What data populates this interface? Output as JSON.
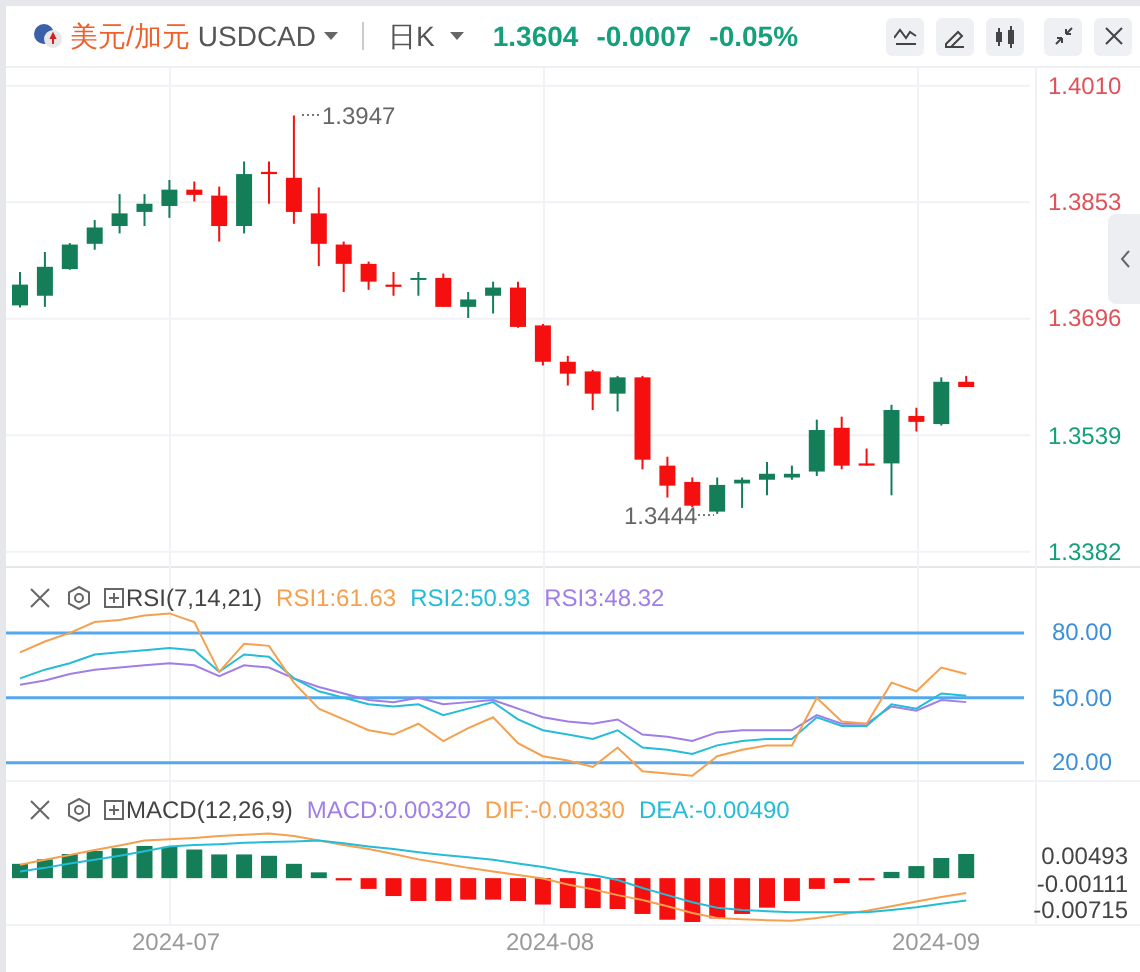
{
  "header": {
    "pair_name": "美元/加元",
    "symbol": "USDCAD",
    "interval": "日K",
    "price": "1.3604",
    "change": "-0.0007",
    "change_percent": "-0.05%"
  },
  "price_chart": {
    "high_marker": "1.3947",
    "low_marker": "1.3444",
    "chart_data": {
      "type": "candlestick",
      "ylim": [
        1.336,
        1.4034
      ],
      "grid": true,
      "yticks": [
        {
          "value": 1.401,
          "label": "1.4010"
        },
        {
          "value": 1.3853,
          "label": "1.3853"
        },
        {
          "value": 1.3696,
          "label": "1.3696"
        },
        {
          "value": 1.3539,
          "label": "1.3539"
        },
        {
          "value": 1.3382,
          "label": "1.3382"
        }
      ],
      "ohlc": [
        [
          1.3714,
          1.3759,
          1.3711,
          1.3742
        ],
        [
          1.3727,
          1.3786,
          1.3712,
          1.3766
        ],
        [
          1.3763,
          1.3798,
          1.3762,
          1.3796
        ],
        [
          1.3797,
          1.3829,
          1.3789,
          1.3819
        ],
        [
          1.3821,
          1.3864,
          1.3811,
          1.3838
        ],
        [
          1.384,
          1.3864,
          1.3821,
          1.3851
        ],
        [
          1.3848,
          1.3883,
          1.3832,
          1.387
        ],
        [
          1.387,
          1.3881,
          1.3854,
          1.3863
        ],
        [
          1.3862,
          1.3874,
          1.38,
          1.3821
        ],
        [
          1.3821,
          1.3908,
          1.3811,
          1.3891
        ],
        [
          1.3894,
          1.3908,
          1.3851,
          1.3891
        ],
        [
          1.3886,
          1.397,
          1.3824,
          1.384
        ],
        [
          1.3838,
          1.3873,
          1.3767,
          1.3797
        ],
        [
          1.3796,
          1.38,
          1.3732,
          1.377
        ],
        [
          1.377,
          1.3773,
          1.3735,
          1.3746
        ],
        [
          1.3742,
          1.3759,
          1.3727,
          1.3739
        ],
        [
          1.3749,
          1.3759,
          1.3727,
          1.3751
        ],
        [
          1.3751,
          1.3757,
          1.3712,
          1.3712
        ],
        [
          1.3712,
          1.3732,
          1.3697,
          1.3722
        ],
        [
          1.3727,
          1.3746,
          1.3703,
          1.3738
        ],
        [
          1.3738,
          1.3746,
          1.3684,
          1.3685
        ],
        [
          1.3687,
          1.3689,
          1.3633,
          1.3638
        ],
        [
          1.3638,
          1.3646,
          1.3606,
          1.3622
        ],
        [
          1.3625,
          1.3627,
          1.3573,
          1.3595
        ],
        [
          1.3595,
          1.3619,
          1.3571,
          1.3617
        ],
        [
          1.3617,
          1.3619,
          1.3493,
          1.3506
        ],
        [
          1.3498,
          1.351,
          1.3455,
          1.3471
        ],
        [
          1.3476,
          1.3482,
          1.3442,
          1.3444
        ],
        [
          1.3436,
          1.3482,
          1.3433,
          1.3472
        ],
        [
          1.3474,
          1.3482,
          1.3441,
          1.3479
        ],
        [
          1.3479,
          1.3503,
          1.3458,
          1.3487
        ],
        [
          1.3482,
          1.3498,
          1.3479,
          1.3487
        ],
        [
          1.349,
          1.356,
          1.3484,
          1.3546
        ],
        [
          1.3549,
          1.3564,
          1.3493,
          1.3498
        ],
        [
          1.3501,
          1.3521,
          1.3498,
          1.3498
        ],
        [
          1.3501,
          1.358,
          1.3458,
          1.3573
        ],
        [
          1.3565,
          1.3576,
          1.3544,
          1.3557
        ],
        [
          1.3554,
          1.3617,
          1.3552,
          1.3611
        ],
        [
          1.3611,
          1.3619,
          1.3604,
          1.3604
        ]
      ]
    }
  },
  "rsi": {
    "title": "RSI(7,14,21)",
    "chart_data": {
      "type": "line",
      "ylim": [
        12,
        110
      ],
      "grid": true,
      "yticks": [
        {
          "value": 80,
          "label": "80.00"
        },
        {
          "value": 50,
          "label": "50.00"
        },
        {
          "value": 20,
          "label": "20.00"
        }
      ],
      "series": [
        {
          "name": "RSI1:61.63",
          "color": "#f5a04e",
          "values": [
            71,
            76,
            80,
            85,
            86,
            88,
            89,
            85,
            62,
            75,
            74,
            57,
            45,
            40,
            35,
            33,
            38,
            30,
            36,
            41,
            29,
            23,
            21,
            18,
            27,
            16,
            15,
            14,
            23,
            26,
            28,
            28,
            50,
            39,
            38,
            57,
            53,
            64,
            61
          ]
        },
        {
          "name": "RSI2:50.93",
          "color": "#25bcd8",
          "values": [
            59,
            63,
            66,
            70,
            71,
            72,
            73,
            72,
            62,
            70,
            69,
            59,
            53,
            50,
            47,
            46,
            47,
            42,
            45,
            48,
            40,
            35,
            33,
            31,
            35,
            27,
            26,
            24,
            28,
            30,
            31,
            31,
            41,
            37,
            37,
            47,
            45,
            52,
            51
          ]
        },
        {
          "name": "RSI3:48.32",
          "color": "#a07ee8",
          "values": [
            56,
            58,
            61,
            63,
            64,
            65,
            66,
            65,
            60,
            65,
            64,
            59,
            55,
            52,
            49,
            48,
            50,
            47,
            48,
            49,
            45,
            41,
            39,
            38,
            40,
            33,
            32,
            30,
            34,
            35,
            35,
            35,
            42,
            38,
            38,
            46,
            44,
            49,
            48
          ]
        }
      ]
    }
  },
  "macd": {
    "title": "MACD(12,26,9)",
    "legend": [
      {
        "label": "MACD:0.00320",
        "color": "#a07ee8"
      },
      {
        "label": "DIF:-0.00330",
        "color": "#f5a04e"
      },
      {
        "label": "DEA:-0.00490",
        "color": "#25bcd8"
      }
    ],
    "chart_data": {
      "type": "bar",
      "ylim": [
        -0.0107,
        0.0215
      ],
      "grid": true,
      "yticks": [
        {
          "value": 0.00493,
          "label": "0.00493"
        },
        {
          "value": -0.00111,
          "label": "-0.00111"
        },
        {
          "value": -0.00715,
          "label": "-0.00715"
        }
      ],
      "series": [
        {
          "color": "#137e58",
          "type": "bar",
          "values": [
            0.0032,
            0.0042,
            0.0054,
            0.0061,
            0.0067,
            0.0072,
            0.007,
            0.0064,
            0.0053,
            0.0053,
            0.005,
            0.0032,
            0.0013,
            null,
            null,
            null,
            null,
            null,
            null,
            null,
            null,
            null,
            null,
            null,
            null,
            null,
            null,
            null,
            null,
            null,
            null,
            null,
            null,
            null,
            null,
            0.0014,
            0.0027,
            0.0045,
            0.0054
          ]
        },
        {
          "color": "#f50f0f",
          "type": "bar",
          "values": [
            null,
            null,
            null,
            null,
            null,
            null,
            null,
            null,
            null,
            null,
            null,
            null,
            null,
            -0.0005,
            -0.0024,
            -0.004,
            -0.0051,
            -0.0051,
            -0.0048,
            -0.0048,
            -0.0051,
            -0.0059,
            -0.0067,
            -0.0067,
            -0.0069,
            -0.008,
            -0.0093,
            -0.0098,
            -0.009,
            -0.008,
            -0.0066,
            -0.0051,
            -0.0024,
            -0.0011,
            -0.0005,
            null,
            null,
            null,
            null
          ]
        },
        {
          "color": "#f5a04e",
          "type": "line",
          "values": [
            0.003,
            0.0041,
            0.0052,
            0.0063,
            0.0073,
            0.0084,
            0.0087,
            0.009,
            0.0094,
            0.0097,
            0.01,
            0.0094,
            0.0084,
            0.0074,
            0.0065,
            0.0054,
            0.0042,
            0.0033,
            0.0023,
            0.0015,
            0.0007,
            -0.0001,
            -0.0014,
            -0.0025,
            -0.0038,
            -0.0049,
            -0.0063,
            -0.0078,
            -0.0089,
            -0.0092,
            -0.0094,
            -0.0095,
            -0.0089,
            -0.0081,
            -0.0073,
            -0.0063,
            -0.0052,
            -0.0042,
            -0.0033
          ]
        },
        {
          "color": "#25bcd8",
          "type": "line",
          "values": [
            0.0015,
            0.0023,
            0.0033,
            0.0041,
            0.005,
            0.006,
            0.0071,
            0.0074,
            0.0076,
            0.0079,
            0.0081,
            0.0082,
            0.0084,
            0.0078,
            0.0071,
            0.0065,
            0.0058,
            0.0052,
            0.0047,
            0.0041,
            0.0033,
            0.0025,
            0.0015,
            0.0007,
            -0.0004,
            -0.0022,
            -0.0038,
            -0.0054,
            -0.0066,
            -0.0071,
            -0.0074,
            -0.0076,
            -0.0076,
            -0.0076,
            -0.0076,
            -0.0071,
            -0.0065,
            -0.0057,
            -0.005
          ]
        }
      ]
    }
  },
  "date_axis": [
    "2024-07",
    "2024-08",
    "2024-09"
  ]
}
